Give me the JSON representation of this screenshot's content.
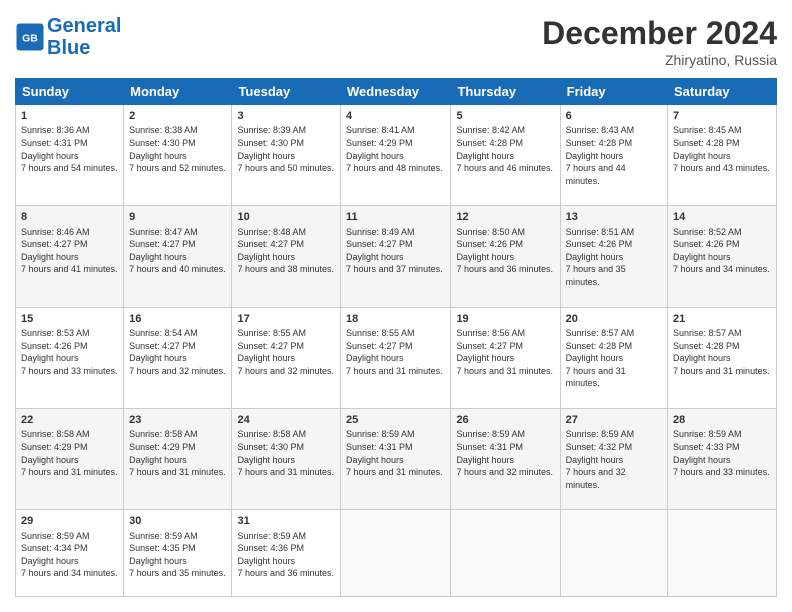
{
  "header": {
    "logo_line1": "General",
    "logo_line2": "Blue",
    "month_year": "December 2024",
    "location": "Zhiryatino, Russia"
  },
  "days_of_week": [
    "Sunday",
    "Monday",
    "Tuesday",
    "Wednesday",
    "Thursday",
    "Friday",
    "Saturday"
  ],
  "weeks": [
    [
      {
        "day": "1",
        "sunrise": "8:36 AM",
        "sunset": "4:31 PM",
        "daylight": "7 hours and 54 minutes."
      },
      {
        "day": "2",
        "sunrise": "8:38 AM",
        "sunset": "4:30 PM",
        "daylight": "7 hours and 52 minutes."
      },
      {
        "day": "3",
        "sunrise": "8:39 AM",
        "sunset": "4:30 PM",
        "daylight": "7 hours and 50 minutes."
      },
      {
        "day": "4",
        "sunrise": "8:41 AM",
        "sunset": "4:29 PM",
        "daylight": "7 hours and 48 minutes."
      },
      {
        "day": "5",
        "sunrise": "8:42 AM",
        "sunset": "4:28 PM",
        "daylight": "7 hours and 46 minutes."
      },
      {
        "day": "6",
        "sunrise": "8:43 AM",
        "sunset": "4:28 PM",
        "daylight": "7 hours and 44 minutes."
      },
      {
        "day": "7",
        "sunrise": "8:45 AM",
        "sunset": "4:28 PM",
        "daylight": "7 hours and 43 minutes."
      }
    ],
    [
      {
        "day": "8",
        "sunrise": "8:46 AM",
        "sunset": "4:27 PM",
        "daylight": "7 hours and 41 minutes."
      },
      {
        "day": "9",
        "sunrise": "8:47 AM",
        "sunset": "4:27 PM",
        "daylight": "7 hours and 40 minutes."
      },
      {
        "day": "10",
        "sunrise": "8:48 AM",
        "sunset": "4:27 PM",
        "daylight": "7 hours and 38 minutes."
      },
      {
        "day": "11",
        "sunrise": "8:49 AM",
        "sunset": "4:27 PM",
        "daylight": "7 hours and 37 minutes."
      },
      {
        "day": "12",
        "sunrise": "8:50 AM",
        "sunset": "4:26 PM",
        "daylight": "7 hours and 36 minutes."
      },
      {
        "day": "13",
        "sunrise": "8:51 AM",
        "sunset": "4:26 PM",
        "daylight": "7 hours and 35 minutes."
      },
      {
        "day": "14",
        "sunrise": "8:52 AM",
        "sunset": "4:26 PM",
        "daylight": "7 hours and 34 minutes."
      }
    ],
    [
      {
        "day": "15",
        "sunrise": "8:53 AM",
        "sunset": "4:26 PM",
        "daylight": "7 hours and 33 minutes."
      },
      {
        "day": "16",
        "sunrise": "8:54 AM",
        "sunset": "4:27 PM",
        "daylight": "7 hours and 32 minutes."
      },
      {
        "day": "17",
        "sunrise": "8:55 AM",
        "sunset": "4:27 PM",
        "daylight": "7 hours and 32 minutes."
      },
      {
        "day": "18",
        "sunrise": "8:55 AM",
        "sunset": "4:27 PM",
        "daylight": "7 hours and 31 minutes."
      },
      {
        "day": "19",
        "sunrise": "8:56 AM",
        "sunset": "4:27 PM",
        "daylight": "7 hours and 31 minutes."
      },
      {
        "day": "20",
        "sunrise": "8:57 AM",
        "sunset": "4:28 PM",
        "daylight": "7 hours and 31 minutes."
      },
      {
        "day": "21",
        "sunrise": "8:57 AM",
        "sunset": "4:28 PM",
        "daylight": "7 hours and 31 minutes."
      }
    ],
    [
      {
        "day": "22",
        "sunrise": "8:58 AM",
        "sunset": "4:29 PM",
        "daylight": "7 hours and 31 minutes."
      },
      {
        "day": "23",
        "sunrise": "8:58 AM",
        "sunset": "4:29 PM",
        "daylight": "7 hours and 31 minutes."
      },
      {
        "day": "24",
        "sunrise": "8:58 AM",
        "sunset": "4:30 PM",
        "daylight": "7 hours and 31 minutes."
      },
      {
        "day": "25",
        "sunrise": "8:59 AM",
        "sunset": "4:31 PM",
        "daylight": "7 hours and 31 minutes."
      },
      {
        "day": "26",
        "sunrise": "8:59 AM",
        "sunset": "4:31 PM",
        "daylight": "7 hours and 32 minutes."
      },
      {
        "day": "27",
        "sunrise": "8:59 AM",
        "sunset": "4:32 PM",
        "daylight": "7 hours and 32 minutes."
      },
      {
        "day": "28",
        "sunrise": "8:59 AM",
        "sunset": "4:33 PM",
        "daylight": "7 hours and 33 minutes."
      }
    ],
    [
      {
        "day": "29",
        "sunrise": "8:59 AM",
        "sunset": "4:34 PM",
        "daylight": "7 hours and 34 minutes."
      },
      {
        "day": "30",
        "sunrise": "8:59 AM",
        "sunset": "4:35 PM",
        "daylight": "7 hours and 35 minutes."
      },
      {
        "day": "31",
        "sunrise": "8:59 AM",
        "sunset": "4:36 PM",
        "daylight": "7 hours and 36 minutes."
      },
      null,
      null,
      null,
      null
    ]
  ]
}
